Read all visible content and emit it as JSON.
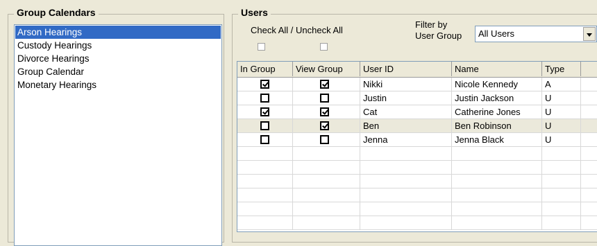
{
  "left_panel": {
    "title": "Group Calendars",
    "items": [
      {
        "label": "Arson Hearings",
        "selected": true
      },
      {
        "label": "Custody Hearings",
        "selected": false
      },
      {
        "label": "Divorce Hearings",
        "selected": false
      },
      {
        "label": "Group Calendar",
        "selected": false
      },
      {
        "label": "Monetary Hearings",
        "selected": false
      }
    ]
  },
  "users_panel": {
    "title": "Users",
    "check_all_label": "Check All / Uncheck All",
    "filter_label_line1": "Filter by",
    "filter_label_line2": "User Group",
    "filter_value": "All Users",
    "columns": [
      "In Group",
      "View Group",
      "User ID",
      "Name",
      "Type"
    ],
    "rows": [
      {
        "in_group": true,
        "view_group": true,
        "user_id": "Nikki",
        "name": "Nicole Kennedy",
        "type": "A",
        "highlight": false
      },
      {
        "in_group": false,
        "view_group": false,
        "user_id": "Justin",
        "name": "Justin Jackson",
        "type": "U",
        "highlight": false
      },
      {
        "in_group": true,
        "view_group": true,
        "user_id": "Cat",
        "name": "Catherine Jones",
        "type": "U",
        "highlight": false
      },
      {
        "in_group": false,
        "view_group": true,
        "user_id": "Ben",
        "name": "Ben Robinson",
        "type": "U",
        "highlight": true
      },
      {
        "in_group": false,
        "view_group": false,
        "user_id": "Jenna",
        "name": "Jenna Black",
        "type": "U",
        "highlight": false
      }
    ]
  },
  "colors": {
    "selection": "#316ac5",
    "background": "#ece9d8",
    "row_highlight": "#ebe9db"
  }
}
